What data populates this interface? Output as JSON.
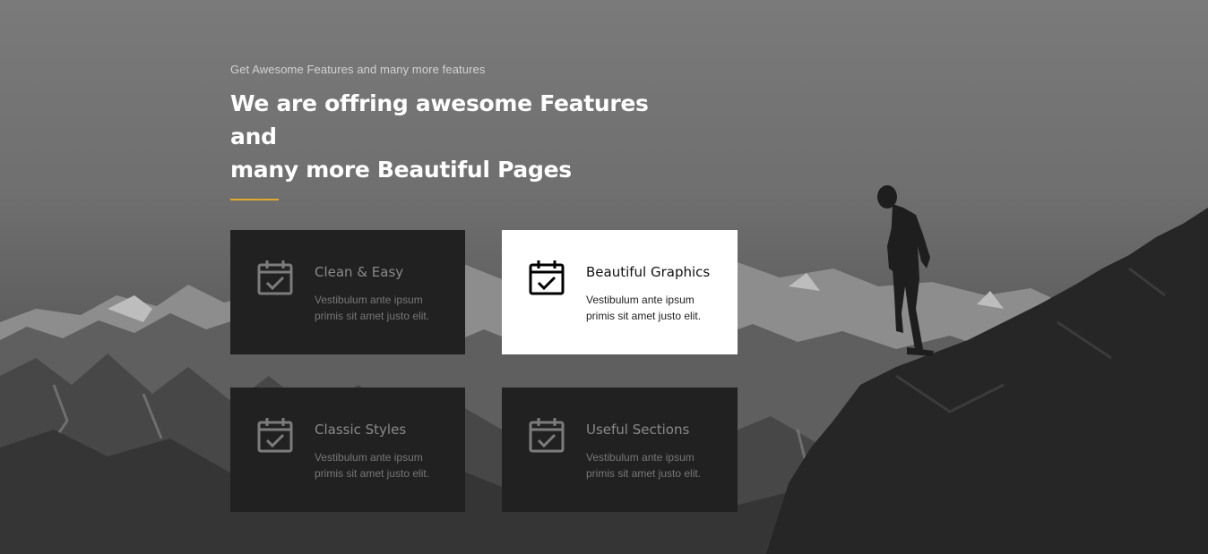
{
  "section": {
    "eyebrow": "Get Awesome Features and many more features",
    "headline_line1": "We are offring awesome Features and",
    "headline_line2": "many more Beautiful Pages",
    "accent_color": "#e0a92c"
  },
  "features": [
    {
      "title": "Clean & Easy",
      "desc_line1": "Vestibulum ante ipsum",
      "desc_line2": "primis sit amet justo elit.",
      "icon": "calendar-check-icon",
      "active": false
    },
    {
      "title": "Beautiful Graphics",
      "desc_line1": "Vestibulum ante ipsum",
      "desc_line2": "primis sit amet justo elit.",
      "icon": "calendar-check-icon",
      "active": true
    },
    {
      "title": "Classic Styles",
      "desc_line1": "Vestibulum ante ipsum",
      "desc_line2": "primis sit amet justo elit.",
      "icon": "calendar-check-icon",
      "active": false
    },
    {
      "title": "Useful Sections",
      "desc_line1": "Vestibulum ante ipsum",
      "desc_line2": "primis sit amet justo elit.",
      "icon": "calendar-check-icon",
      "active": false
    }
  ],
  "colors": {
    "card_dark": "#212121",
    "card_active": "#ffffff"
  }
}
